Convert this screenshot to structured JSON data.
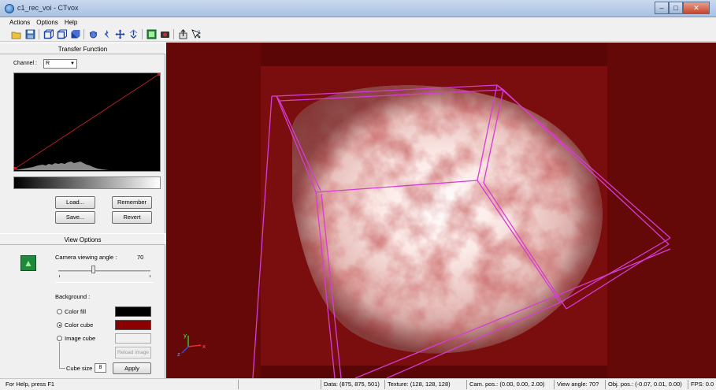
{
  "window": {
    "title": "c1_rec_voi - CTvox"
  },
  "menu": {
    "items": [
      "Actions",
      "Options",
      "Help"
    ]
  },
  "toolbar": {
    "icons": [
      "open-icon",
      "save-icon",
      "cube-outline-icon",
      "cube-front-icon",
      "cube-solid-icon",
      "rotate-icon",
      "lighting-icon",
      "move-icon",
      "zoom-icon",
      "camera-icon",
      "record-icon",
      "export-icon",
      "help-icon"
    ]
  },
  "transfer_function": {
    "section_title": "Transfer Function",
    "channel_label": "Channel :",
    "channel_value": "R",
    "load_label": "Load...",
    "save_label": "Save...",
    "remember_label": "Remember",
    "revert_label": "Revert"
  },
  "view_options": {
    "section_title": "View Options",
    "camera_angle_label": "Camera viewing angle :",
    "camera_angle_value": "70",
    "camera_angle_fraction": 0.38,
    "background_label": "Background :",
    "color_fill_label": "Color fill",
    "color_cube_label": "Color cube",
    "image_cube_label": "Image cube",
    "selected_background": "color_cube",
    "reload_image_label": "Reload image",
    "cube_size_label": "Cube size",
    "cube_size_value": "8",
    "apply_label": "Apply",
    "color_fill_color": "#000000",
    "color_cube_color": "#8b0000"
  },
  "statusbar": {
    "help_text": "For Help, press F1",
    "data": "Data: (875, 875, 501)",
    "texture": "Texture: (128, 128, 128)",
    "cam_pos": "Cam. pos.: (0.00, 0.00, 2.00)",
    "view_angle": "View angle: 70?",
    "obj_pos": "Obj. pos.: (-0.07, 0.01, 0.00)",
    "fps": "FPS: 0.0"
  },
  "viewport": {
    "background_color": "#5a0606",
    "box_color": "#d63cd6",
    "axis_labels": [
      "y",
      "x",
      "z"
    ]
  }
}
